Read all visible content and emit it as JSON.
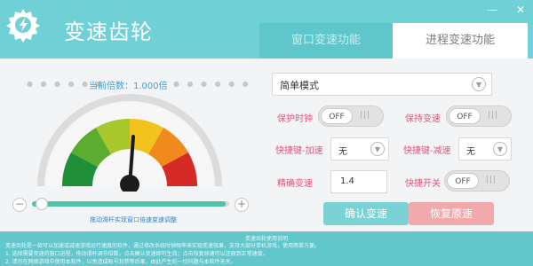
{
  "app": {
    "title": "变速齿轮",
    "logo_icon": "gear-lightning-icon",
    "window_controls": [
      "minimize",
      "close"
    ]
  },
  "tabs": [
    {
      "label": "窗口变速功能",
      "active": true
    },
    {
      "label": "进程变速功能",
      "active": false
    }
  ],
  "gauge": {
    "speed_label": "当前倍数：1.000倍",
    "value": 1.0,
    "hint": "拖动滑杆实现窗口倍速变速调整"
  },
  "slider": {
    "fraction": 0.02
  },
  "controls": {
    "mode_value": "简单模式",
    "protect_label": "保护时钟",
    "protect_state": "OFF",
    "keep_label": "保持变速",
    "keep_state": "OFF",
    "hotkey_up_label": "快捷键-加速",
    "hotkey_up_value": "无",
    "hotkey_down_label": "快捷键-减速",
    "hotkey_down_value": "无",
    "precise_label": "精确变速",
    "precise_value": "1.4",
    "hotkey_switch_label": "快捷开关",
    "hotkey_switch_state": "OFF",
    "confirm_button": "确认变速",
    "restore_button": "恢复原速"
  },
  "footer": {
    "title": "变速齿轮使用说明",
    "lines": [
      "变速齿轮是一款可以加速或减速游戏运行速度的软件，通过修改系统时钟频率来实现变速效果，支持大部分单机游戏，使用简单方便。",
      "1. 选择需要变速的窗口进程，拖动滑杆调节倍数，点击确认变速即可生效；点击恢复原速可以还原到正常速度。",
      "2. 请勿在网络游戏中使用本软件，以免造成账号封禁等后果，由此产生的一切问题与本软件无关。"
    ]
  },
  "colors": {
    "brand": "#6fd0d6",
    "label_pink": "#e0557b",
    "confirm": "#7ad2d5",
    "restore": "#f2a9ac"
  }
}
